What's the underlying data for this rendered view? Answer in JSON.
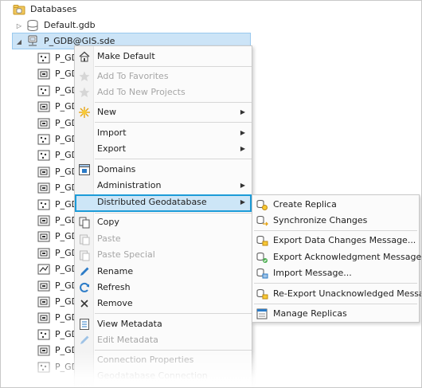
{
  "tree": {
    "databases_label": "Databases",
    "default_gdb_label": "Default.gdb",
    "selected_connection_label": "P_GDB@GIS.sde",
    "child_label_prefix": "P_GDE",
    "child_first_label": "P_GDB",
    "child_count": 20
  },
  "context_menu": {
    "items": [
      {
        "label": "Make Default",
        "icon": "home-icon",
        "enabled": true
      },
      {
        "label": "Add To Favorites",
        "icon": "star-icon",
        "enabled": false
      },
      {
        "label": "Add To New Projects",
        "icon": "star-icon",
        "enabled": false
      },
      {
        "label": "New",
        "icon": "sun-new-icon",
        "enabled": true,
        "submenu": true
      },
      {
        "label": "Import",
        "icon": "",
        "enabled": true,
        "submenu": true
      },
      {
        "label": "Export",
        "icon": "",
        "enabled": true,
        "submenu": true
      },
      {
        "label": "Domains",
        "icon": "domains-icon",
        "enabled": true
      },
      {
        "label": "Administration",
        "icon": "",
        "enabled": true,
        "submenu": true
      },
      {
        "label": "Distributed Geodatabase",
        "icon": "",
        "enabled": true,
        "submenu": true
      },
      {
        "label": "Copy",
        "icon": "copy-icon",
        "enabled": true
      },
      {
        "label": "Paste",
        "icon": "paste-icon",
        "enabled": false
      },
      {
        "label": "Paste Special",
        "icon": "paste-special-icon",
        "enabled": false
      },
      {
        "label": "Rename",
        "icon": "pencil-icon",
        "enabled": true
      },
      {
        "label": "Refresh",
        "icon": "refresh-icon",
        "enabled": true
      },
      {
        "label": "Remove",
        "icon": "x-icon",
        "enabled": true
      },
      {
        "label": "View Metadata",
        "icon": "metadata-icon",
        "enabled": true
      },
      {
        "label": "Edit Metadata",
        "icon": "edit-pencil-icon",
        "enabled": false
      },
      {
        "label": "Connection Properties",
        "icon": "",
        "enabled": false
      },
      {
        "label": "Geodatabase Connection Properties",
        "icon": "",
        "enabled": false
      }
    ]
  },
  "submenu": {
    "items": [
      {
        "label": "Create Replica",
        "icon": "create-replica-icon"
      },
      {
        "label": "Synchronize Changes",
        "icon": "synchronize-icon"
      },
      {
        "label": "Export Data Changes Message...",
        "icon": "export-data-changes-icon"
      },
      {
        "label": "Export Acknowledgment Message...",
        "icon": "export-ack-icon"
      },
      {
        "label": "Import Message...",
        "icon": "import-message-icon"
      },
      {
        "label": "Re-Export Unacknowledged Messages...",
        "icon": "reexport-icon"
      },
      {
        "label": "Manage Replicas",
        "icon": "manage-replicas-icon"
      }
    ]
  },
  "colors": {
    "selection_bg": "#cce4f7",
    "highlight_border": "#1c9bd8",
    "disabled_text": "#a6a6a6",
    "icon_blue": "#2b7bc7",
    "icon_yellow": "#e6b422"
  }
}
